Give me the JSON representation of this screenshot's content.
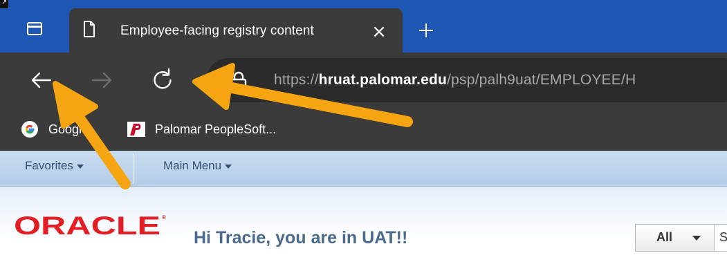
{
  "browser": {
    "tab": {
      "title": "Employee-facing registry content",
      "close_glyph": "×"
    },
    "toolbar": {
      "url_prefix": "https://",
      "url_host": "hruat.palomar.edu",
      "url_path": "/psp/palh9uat/EMPLOYEE/H"
    },
    "bookmarks": [
      {
        "label": "Google",
        "icon": "google-icon"
      },
      {
        "label": "Palomar PeopleSoft...",
        "icon": "palomar-p-icon"
      }
    ],
    "accent_color": "#1f58b4"
  },
  "peoplesoft": {
    "nav": {
      "favorites_label": "Favorites",
      "main_menu_label": "Main Menu"
    },
    "header": {
      "logo_text": "ORACLE",
      "greeting": "Hi Tracie, you are in UAT!!",
      "search_scope": "All",
      "search_value": "S"
    },
    "logo_color": "#e31e24"
  },
  "annotations": {
    "arrow_color": "#f5a511",
    "arrows": [
      "arrow-to-back-button",
      "arrow-to-refresh-button"
    ]
  }
}
